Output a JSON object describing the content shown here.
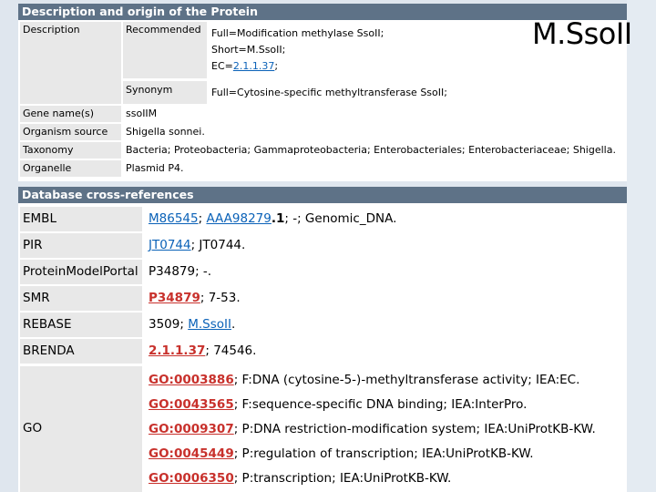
{
  "slide_title": "M.SsoII",
  "section1": {
    "header": "Description and origin of the Protein",
    "description_label": "Description",
    "recommended_label": "Recommended",
    "recommended": {
      "full": "Full=Modification methylase SsoII;",
      "short": "Short=M.SsoII;",
      "ec_prefix": "EC=",
      "ec_link": "2.1.1.37",
      "ec_suffix": ";"
    },
    "synonym_label": "Synonym",
    "synonym_value": "Full=Cytosine-specific methyltransferase SsoII;",
    "rows": [
      {
        "label": "Gene name(s)",
        "value": "ssoIIM"
      },
      {
        "label": "Organism source",
        "value": "Shigella sonnei."
      },
      {
        "label": "Taxonomy",
        "value": "Bacteria; Proteobacteria; Gammaproteobacteria; Enterobacteriales; Enterobacteriaceae; Shigella."
      },
      {
        "label": "Organelle",
        "value": "Plasmid P4."
      }
    ]
  },
  "section2": {
    "header": "Database cross-references",
    "embl": {
      "label": "EMBL",
      "link1": "M86545",
      "sep": "; ",
      "link2": "AAA98279",
      "bold": ".1",
      "rest": "; -; Genomic_DNA."
    },
    "pir": {
      "label": "PIR",
      "link": "JT0744",
      "rest": "; JT0744."
    },
    "pmp": {
      "label": "ProteinModelPortal",
      "value": "P34879; -."
    },
    "smr": {
      "label": "SMR",
      "link": "P34879",
      "rest": "; 7-53."
    },
    "rebase": {
      "label": "REBASE",
      "prefix": "3509; ",
      "link": "M.SsoII",
      "rest": "."
    },
    "brenda": {
      "label": "BRENDA",
      "link": "2.1.1.37",
      "rest": "; 74546."
    },
    "go": {
      "label": "GO",
      "items": [
        {
          "id": "GO:0003886",
          "text": "; F:DNA (cytosine-5-)-methyltransferase activity; IEA:EC."
        },
        {
          "id": "GO:0043565",
          "text": "; F:sequence-specific DNA binding; IEA:InterPro."
        },
        {
          "id": "GO:0009307",
          "text": "; P:DNA restriction-modification system; IEA:UniProtKB-KW."
        },
        {
          "id": "GO:0045449",
          "text": "; P:regulation of transcription; IEA:UniProtKB-KW."
        },
        {
          "id": "GO:0006350",
          "text": "; P:transcription; IEA:UniProtKB-KW."
        }
      ]
    }
  }
}
